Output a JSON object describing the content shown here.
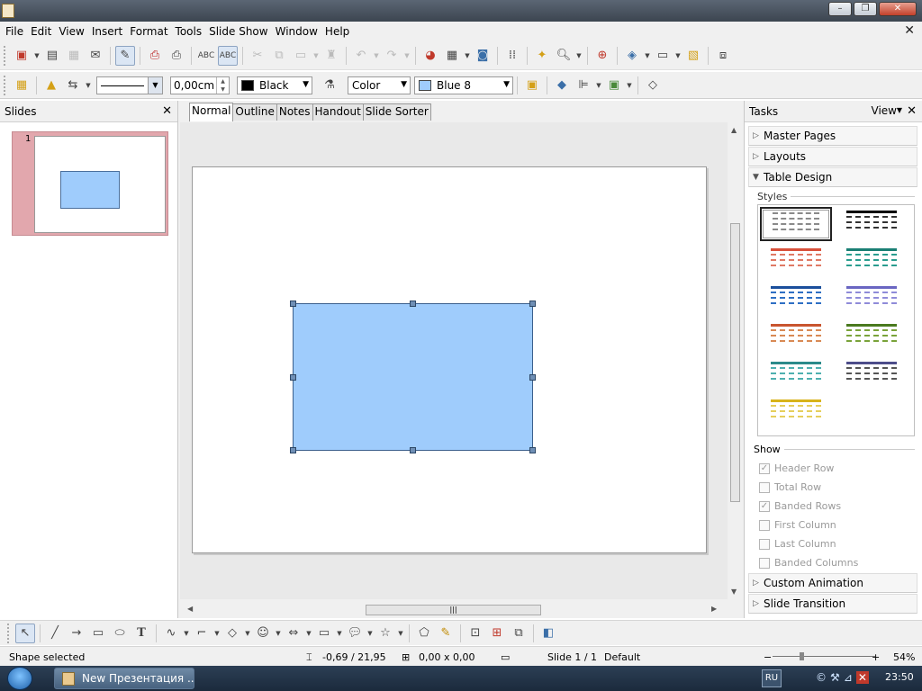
{
  "menu": [
    "File",
    "Edit",
    "View",
    "Insert",
    "Format",
    "Tools",
    "Slide Show",
    "Window",
    "Help"
  ],
  "toolbar2": {
    "line_width": "0,00cm",
    "line_color": "Black",
    "area_style": "Color",
    "area_color": "Blue 8"
  },
  "colors": {
    "shape_fill": "#9fccfc",
    "thumb_bg": "#e2a7ad"
  },
  "slides_panel": {
    "title": "Slides",
    "slide_number": "1"
  },
  "view_tabs": [
    "Normal",
    "Outline",
    "Notes",
    "Handout",
    "Slide Sorter"
  ],
  "tasks": {
    "title": "Tasks",
    "view_label": "View",
    "sections_top": [
      "Master Pages",
      "Layouts"
    ],
    "open_section": "Table Design",
    "styles_label": "Styles",
    "show_label": "Show",
    "show_options": [
      {
        "label": "Header Row",
        "checked": true
      },
      {
        "label": "Total Row",
        "checked": false
      },
      {
        "label": "Banded Rows",
        "checked": true
      },
      {
        "label": "First Column",
        "checked": false
      },
      {
        "label": "Last Column",
        "checked": false
      },
      {
        "label": "Banded Columns",
        "checked": false
      }
    ],
    "sections_bottom": [
      "Custom Animation",
      "Slide Transition"
    ]
  },
  "status": {
    "message": "Shape selected",
    "position": "-0,69 / 21,95",
    "size": "0,00 x 0,00",
    "slide": "Slide 1 / 1",
    "master": "Default",
    "zoom": "54%"
  },
  "taskbar": {
    "window": "New Презентация ...",
    "lang": "RU",
    "time": "23:50"
  }
}
